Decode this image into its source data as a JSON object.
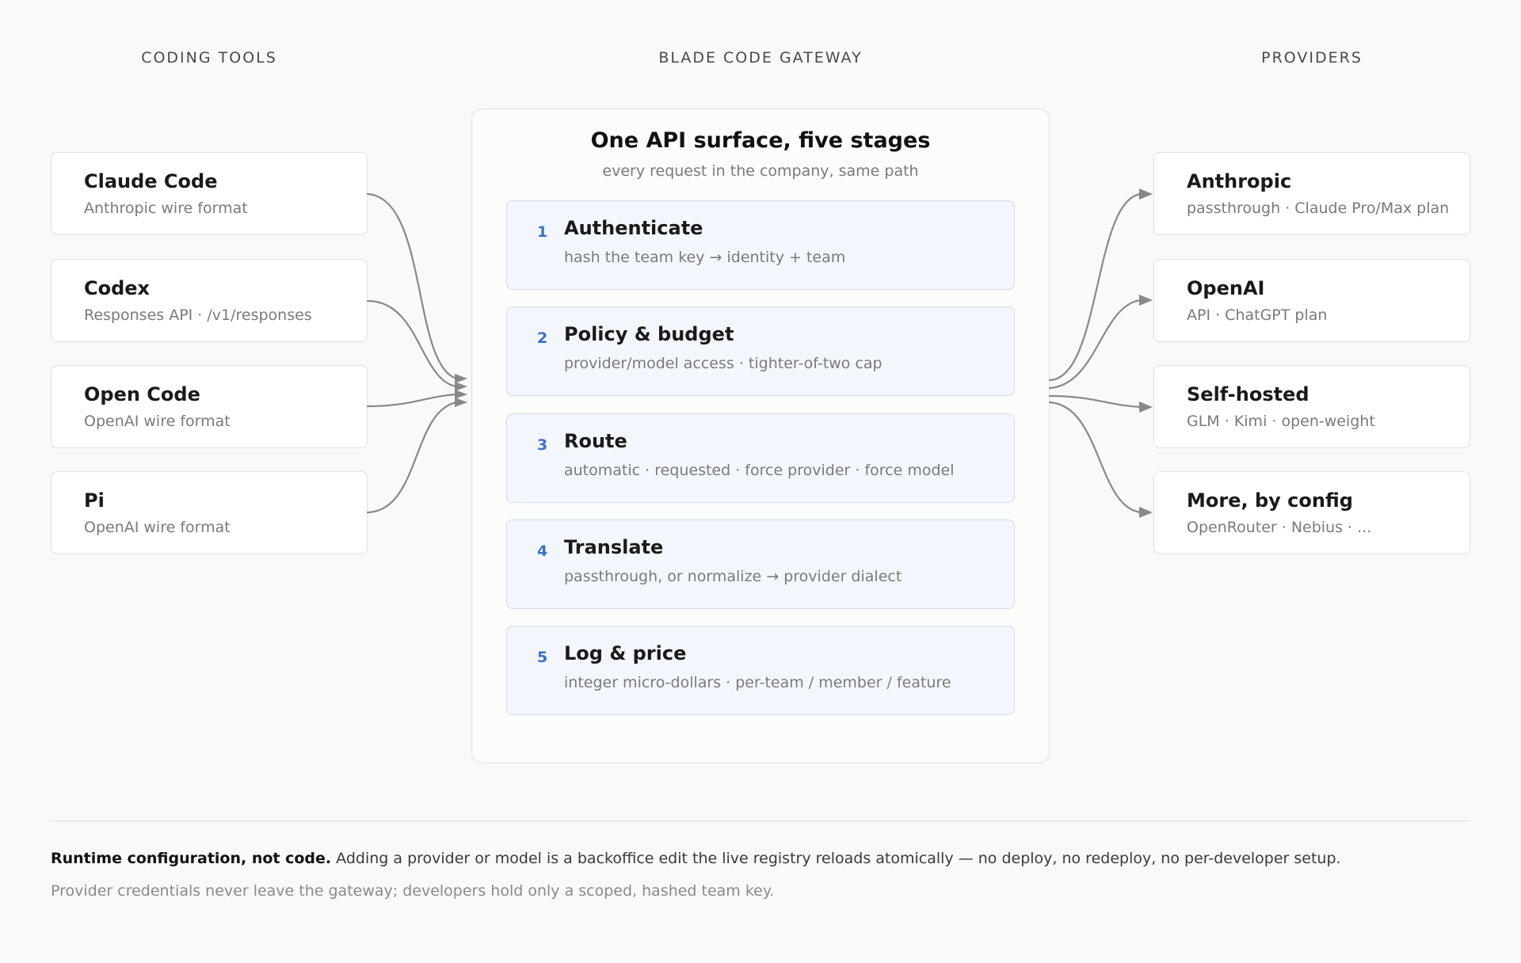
{
  "headers": {
    "left": "CODING TOOLS",
    "center": "BLADE CODE GATEWAY",
    "right": "PROVIDERS"
  },
  "tools": [
    {
      "title": "Claude Code",
      "sub": "Anthropic wire format"
    },
    {
      "title": "Codex",
      "sub": "Responses API · /v1/responses"
    },
    {
      "title": "Open Code",
      "sub": "OpenAI wire format"
    },
    {
      "title": "Pi",
      "sub": "OpenAI wire format"
    }
  ],
  "gateway": {
    "title": "One API surface, five stages",
    "subtitle": "every request in the company, same path",
    "stages": [
      {
        "num": "1",
        "title": "Authenticate",
        "sub": "hash the team key → identity + team"
      },
      {
        "num": "2",
        "title": "Policy & budget",
        "sub": "provider/model access · tighter-of-two cap"
      },
      {
        "num": "3",
        "title": "Route",
        "sub": "automatic · requested · force provider · force model"
      },
      {
        "num": "4",
        "title": "Translate",
        "sub": "passthrough, or normalize → provider dialect"
      },
      {
        "num": "5",
        "title": "Log & price",
        "sub": "integer micro-dollars · per-team / member / feature"
      }
    ]
  },
  "providers": [
    {
      "title": "Anthropic",
      "sub": "passthrough · Claude Pro/Max plan"
    },
    {
      "title": "OpenAI",
      "sub": "API · ChatGPT plan"
    },
    {
      "title": "Self-hosted",
      "sub": "GLM · Kimi · open-weight"
    },
    {
      "title": "More, by config",
      "sub": "OpenRouter · Nebius · ..."
    }
  ],
  "footer": {
    "bold": "Runtime configuration, not code.",
    "text": " Adding a provider or model is a backoffice edit the live registry reloads atomically — no deploy, no redeploy, no per-developer setup.",
    "note": "Provider credentials never leave the gateway; developers hold only a scoped, hashed team key."
  },
  "colors": {
    "arrow": "#888888",
    "stage_number": "#3a72c4",
    "stage_fill": "#f3f7fd",
    "stage_border": "#cddcf0"
  }
}
